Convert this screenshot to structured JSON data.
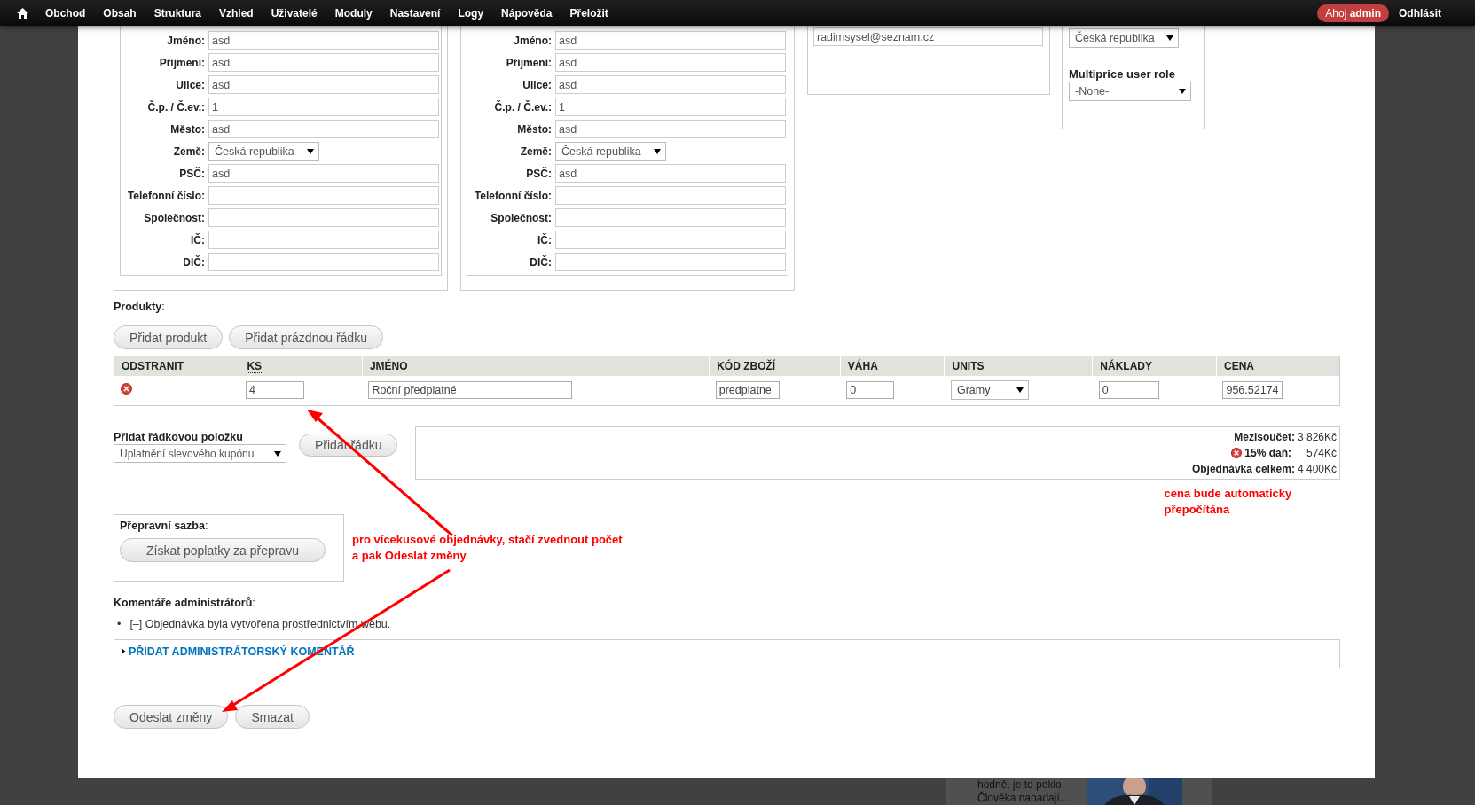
{
  "toolbar": {
    "menu": [
      "Obchod",
      "Obsah",
      "Struktura",
      "Vzhled",
      "Uživatelé",
      "Moduly",
      "Nastavení",
      "Logy",
      "Nápověda",
      "Přeložit"
    ],
    "greeting": "Ahoj **admin**",
    "logout": "Odhlásit"
  },
  "addresses": [
    {
      "fields": [
        {
          "label": "Jméno:",
          "value": "asd",
          "kind": "text"
        },
        {
          "label": "Příjmení:",
          "value": "asd",
          "kind": "text"
        },
        {
          "label": "Ulice:",
          "value": "asd",
          "kind": "text"
        },
        {
          "label": "Č.p. / Č.ev.:",
          "value": "1",
          "kind": "text"
        },
        {
          "label": "Město:",
          "value": "asd",
          "kind": "text"
        },
        {
          "label": "Země:",
          "value": "Česká republika",
          "kind": "select"
        },
        {
          "label": "PSČ:",
          "value": "asd",
          "kind": "text"
        },
        {
          "label": "Telefonní číslo:",
          "kind": "text"
        },
        {
          "label": "Společnost:",
          "kind": "text"
        },
        {
          "label": "IČ:",
          "kind": "text"
        },
        {
          "label": "DIČ:",
          "kind": "text"
        }
      ]
    },
    {
      "fields": [
        {
          "label": "Jméno:",
          "value": "asd",
          "kind": "text"
        },
        {
          "label": "Příjmení:",
          "value": "asd",
          "kind": "text"
        },
        {
          "label": "Ulice:",
          "value": "asd",
          "kind": "text"
        },
        {
          "label": "Č.p. / Č.ev.:",
          "value": "1",
          "kind": "text"
        },
        {
          "label": "Město:",
          "value": "asd",
          "kind": "text"
        },
        {
          "label": "Země:",
          "value": "Česká republika",
          "kind": "select"
        },
        {
          "label": "PSČ:",
          "value": "asd",
          "kind": "text"
        },
        {
          "label": "Telefonní číslo:",
          "kind": "text"
        },
        {
          "label": "Společnost:",
          "kind": "text"
        },
        {
          "label": "IČ:",
          "kind": "text"
        },
        {
          "label": "DIČ:",
          "kind": "text"
        }
      ]
    }
  ],
  "email": "radimsysel@seznam.cz",
  "multiprice": {
    "country": "Česká republika",
    "role_label": "Multiprice user role",
    "role": "-None-"
  },
  "products": {
    "label": "**Produkty**:",
    "buttons": [
      "Přidat produkt",
      "Přidat prázdnou řádku"
    ],
    "columns": [
      {
        "label": "ODSTRANIT",
        "abbr": false
      },
      {
        "label": "KS",
        "abbr": true
      },
      {
        "label": "JMÉNO",
        "abbr": false
      },
      {
        "label": "KÓD ZBOŽÍ",
        "abbr": false
      },
      {
        "label": "VÁHA",
        "abbr": false
      },
      {
        "label": "UNITS",
        "abbr": false
      },
      {
        "label": "NÁKLADY",
        "abbr": false
      },
      {
        "label": "CENA",
        "abbr": false
      }
    ],
    "rows": [
      {
        "quantity": "4",
        "name": "Roční předplatné",
        "sku": "predplatne",
        "weight": "0",
        "units": "Gramy",
        "cost": "0.",
        "price": "956.52174"
      }
    ]
  },
  "line_item": {
    "label": "Přidat řádkovou položku",
    "select": "Uplatnění slevového kupónu",
    "button": "Přidat řádku"
  },
  "totals": [
    {
      "label": "Mezisoučet:",
      "value": "3 826Kč",
      "removable": false
    },
    {
      "label": "15% daň:",
      "value": "574Kč",
      "removable": true
    },
    {
      "label": "Objednávka celkem:",
      "value": "4 400Kč",
      "removable": false
    }
  ],
  "price_note": [
    "cena bude automaticky",
    "přepočítána"
  ],
  "shipping": {
    "label": "**Přepravní sazba**:",
    "button": "Získat poplatky za přepravu"
  },
  "quantity_note": [
    "pro vícekusové objednávky, stačí zvednout počet",
    "a pak Odeslat změny"
  ],
  "comments": {
    "heading": "**Komentáře administrátorů**:",
    "items": [
      {
        "bullet": "•",
        "text": "[–] Objednávka byla vytvořena prostřednictvím webu."
      }
    ],
    "add_link": "PŘIDAT ADMINISTRÁTORSKÝ KOMENTÁŘ"
  },
  "actions": [
    "Odeslat změny",
    "Smazat"
  ],
  "background": {
    "lines": [
      "hodně, je to peklo.",
      "Člověka napadají..."
    ]
  }
}
